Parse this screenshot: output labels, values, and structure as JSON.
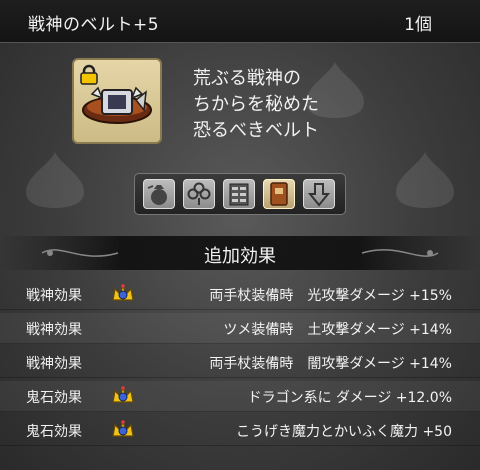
{
  "item": {
    "name": "戦神のベルト+5",
    "count": "1個",
    "icon": "belt-item-icon",
    "locked": true,
    "description": [
      "荒ぶる戦神の",
      "ちからを秘めた",
      "恐るべきベルト"
    ]
  },
  "tabs": [
    {
      "icon": "bag-icon",
      "active": false
    },
    {
      "icon": "clover-icon",
      "active": false
    },
    {
      "icon": "cabinet-icon",
      "active": false
    },
    {
      "icon": "book-icon",
      "active": true
    },
    {
      "icon": "down-arrow-icon",
      "active": false
    }
  ],
  "section": {
    "title": "追加効果"
  },
  "effects": [
    {
      "type": "戦神効果",
      "crown": true,
      "text": "両手杖装備時　光攻撃ダメージ +15%"
    },
    {
      "type": "戦神効果",
      "crown": false,
      "text": "ツメ装備時　土攻撃ダメージ +14%"
    },
    {
      "type": "戦神効果",
      "crown": false,
      "text": "両手杖装備時　闇攻撃ダメージ +14%"
    },
    {
      "type": "鬼石効果",
      "crown": true,
      "text": "ドラゴン系に ダメージ +12.0%"
    },
    {
      "type": "鬼石効果",
      "crown": true,
      "text": "こうげき魔力とかいふく魔力 +50"
    }
  ],
  "colors": {
    "accent_gold": "#e6d6a8",
    "crown_blue": "#3a64d6",
    "text": "#f2f2f2"
  }
}
